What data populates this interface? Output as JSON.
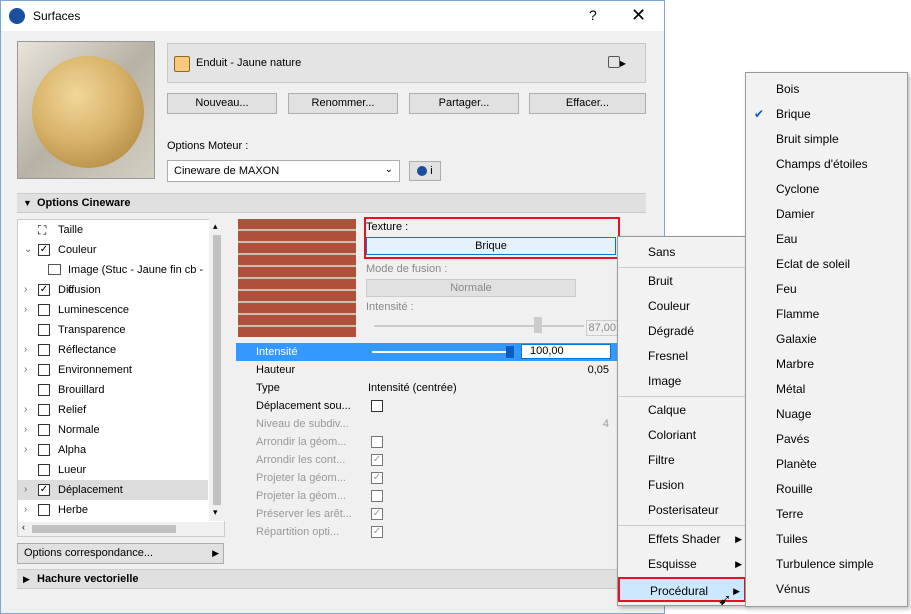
{
  "window": {
    "title": "Surfaces",
    "help": "?",
    "close": "✕"
  },
  "surface": {
    "name": "Enduit - Jaune nature",
    "swatch_color": "#f8c87c",
    "menu_icon": "▸"
  },
  "buttons": {
    "new": "Nouveau...",
    "rename": "Renommer...",
    "share": "Partager...",
    "delete": "Effacer..."
  },
  "engine": {
    "label": "Options Moteur :",
    "value": "Cineware de MAXON",
    "info": "i"
  },
  "sections": {
    "cineware": "Options Cineware",
    "mapping": "Options correspondance...",
    "hatch": "Hachure vectorielle"
  },
  "tree": [
    {
      "label": "Taille",
      "icon": "size-icon"
    },
    {
      "label": "Couleur",
      "checked": true,
      "expanded": true
    },
    {
      "label": "Image (Stuc - Jaune fin cb -c",
      "icon": "image-icon"
    },
    {
      "label": "Diffusion",
      "checked": true
    },
    {
      "label": "Luminescence",
      "checked": false
    },
    {
      "label": "Transparence",
      "checked": false
    },
    {
      "label": "Réflectance",
      "checked": false
    },
    {
      "label": "Environnement",
      "checked": false
    },
    {
      "label": "Brouillard",
      "checked": false
    },
    {
      "label": "Relief",
      "checked": false
    },
    {
      "label": "Normale",
      "checked": false
    },
    {
      "label": "Alpha",
      "checked": false
    },
    {
      "label": "Lueur",
      "checked": false
    },
    {
      "label": "Déplacement",
      "checked": true,
      "selected": true
    },
    {
      "label": "Herbe",
      "checked": false
    }
  ],
  "texture": {
    "label": "Texture :",
    "value": "Brique",
    "blend_label": "Mode de fusion :",
    "blend_value": "Normale",
    "intensity_label": "Intensité :",
    "intensity_value": "87,00"
  },
  "props": [
    {
      "name": "Intensité",
      "value": "100,00",
      "highlight": true
    },
    {
      "name": "Hauteur",
      "value": "0,05"
    },
    {
      "name": "Type",
      "value": "Intensité (centrée)"
    },
    {
      "name": "Déplacement sou...",
      "check": false
    },
    {
      "name": "Niveau de subdiv...",
      "value": "4",
      "disabled": true
    },
    {
      "name": "Arrondir la géom...",
      "check": false,
      "disabled": true
    },
    {
      "name": "Arrondir les cont...",
      "check": true,
      "disabled": true
    },
    {
      "name": "Projeter la géom...",
      "check": true,
      "disabled": true
    },
    {
      "name": "Projeter la géom...",
      "check": false,
      "disabled": true
    },
    {
      "name": "Préserver les arêt...",
      "check": true,
      "disabled": true
    },
    {
      "name": "Répartition opti...",
      "check": true,
      "disabled": true
    }
  ],
  "menu1": [
    {
      "label": "Sans"
    },
    {
      "label": "Bruit"
    },
    {
      "label": "Couleur"
    },
    {
      "label": "Dégradé"
    },
    {
      "label": "Fresnel"
    },
    {
      "label": "Image"
    },
    {
      "label": "Calque"
    },
    {
      "label": "Coloriant"
    },
    {
      "label": "Filtre"
    },
    {
      "label": "Fusion"
    },
    {
      "label": "Posterisateur"
    },
    {
      "label": "Effets Shader",
      "submenu": true
    },
    {
      "label": "Esquisse",
      "submenu": true
    },
    {
      "label": "Procédural",
      "submenu": true,
      "active": true
    }
  ],
  "menu2": [
    {
      "label": "Bois"
    },
    {
      "label": "Brique",
      "checked": true
    },
    {
      "label": "Bruit simple"
    },
    {
      "label": "Champs d'étoiles"
    },
    {
      "label": "Cyclone"
    },
    {
      "label": "Damier"
    },
    {
      "label": "Eau"
    },
    {
      "label": "Eclat de soleil"
    },
    {
      "label": "Feu"
    },
    {
      "label": "Flamme"
    },
    {
      "label": "Galaxie"
    },
    {
      "label": "Marbre"
    },
    {
      "label": "Métal"
    },
    {
      "label": "Nuage"
    },
    {
      "label": "Pavés"
    },
    {
      "label": "Planète"
    },
    {
      "label": "Rouille"
    },
    {
      "label": "Terre"
    },
    {
      "label": "Tuiles"
    },
    {
      "label": "Turbulence simple"
    },
    {
      "label": "Vénus"
    }
  ],
  "colors": {
    "accent": "#3399ff",
    "highlight_border": "#e81123",
    "menu_active": "#cce8ff"
  }
}
